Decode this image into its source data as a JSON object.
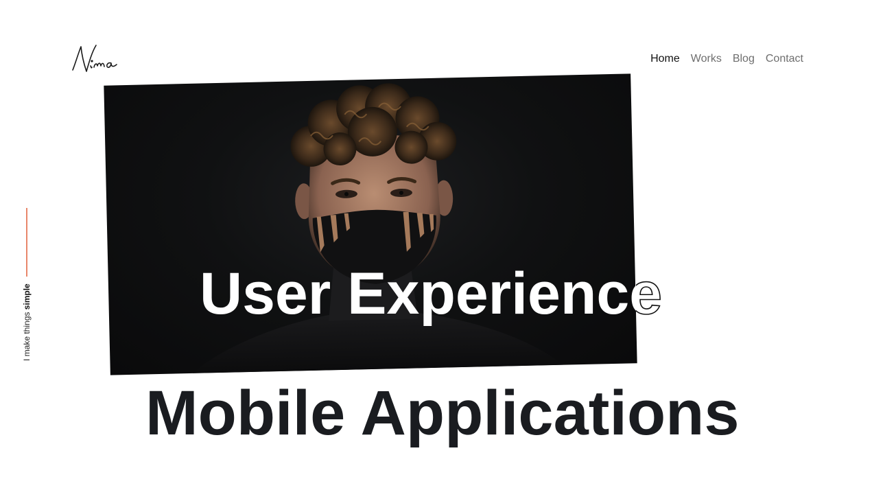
{
  "brand": {
    "logo_text": "Nima"
  },
  "nav": {
    "items": [
      {
        "label": "Home",
        "active": true
      },
      {
        "label": "Works",
        "active": false
      },
      {
        "label": "Blog",
        "active": false
      },
      {
        "label": "Contact",
        "active": false
      }
    ]
  },
  "side": {
    "tagline_prefix": "I make things",
    "tagline_bold": "simple",
    "accent_color": "#e8866a"
  },
  "hero": {
    "headline": "User Experience",
    "subheadline": "Mobile Applications",
    "image_icon": "portrait-photo"
  },
  "colors": {
    "text_dark": "#1a1c20",
    "nav_muted": "#6e6e6e",
    "accent": "#e8866a"
  }
}
